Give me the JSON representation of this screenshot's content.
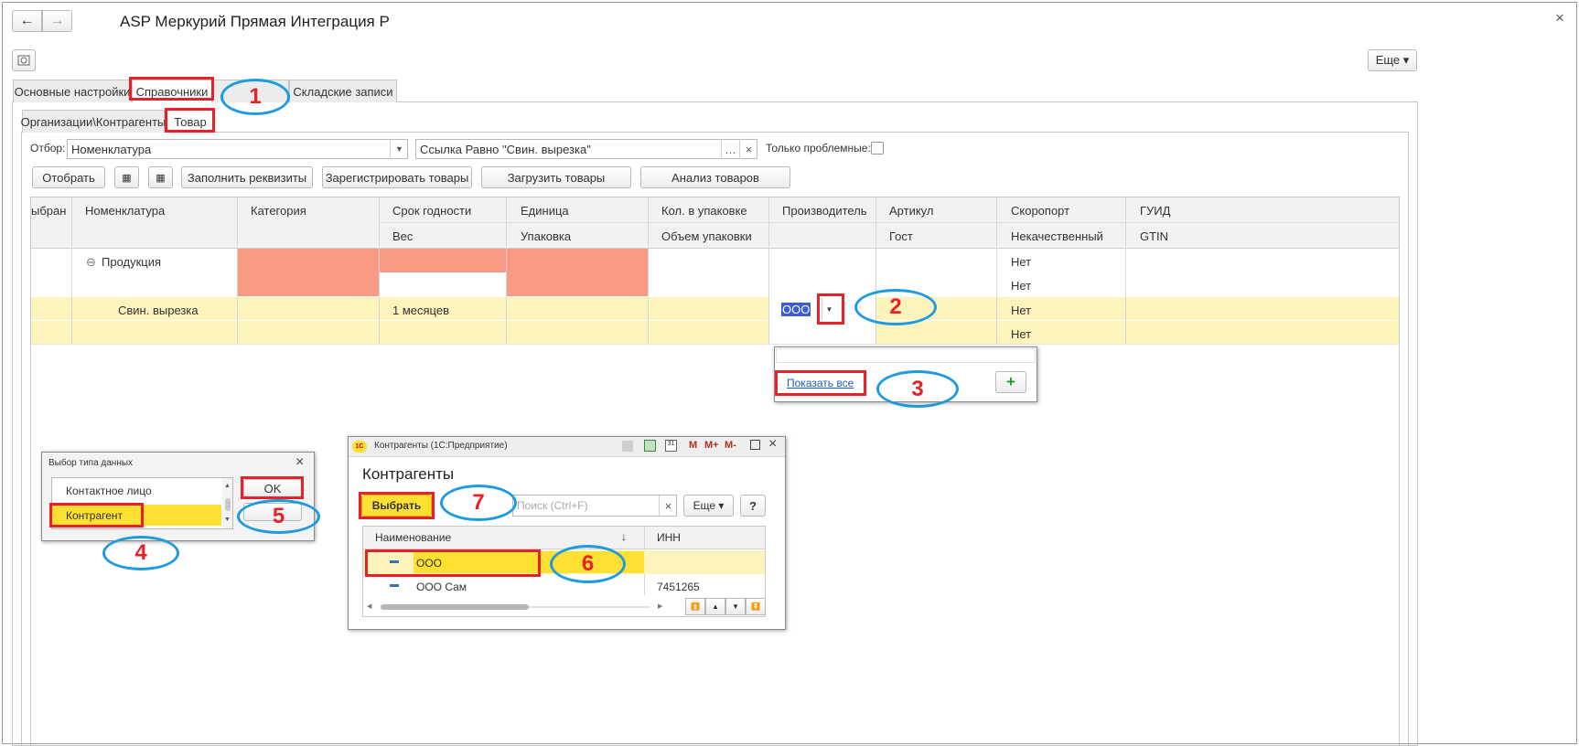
{
  "window": {
    "title": "ASP Меркурий Прямая Интеграция Р",
    "back_icon": "←",
    "forward_icon": "→",
    "close_icon": "×",
    "more_label": "Еще ▾"
  },
  "tabs": {
    "main": [
      "Основные настройки",
      "Справочники",
      "",
      "Складские записи"
    ],
    "sub": [
      "Организации\\Контрагенты",
      "Товар"
    ]
  },
  "filter": {
    "label": "Отбор:",
    "field_value": "Номенклатура",
    "condition_value": "Ссылка Равно \"Свин. вырезка\"",
    "problem_only_label": "Только проблемные:"
  },
  "toolbar": {
    "select": "Отобрать",
    "fill_props": "Заполнить реквизиты",
    "register_goods": "Зарегистрировать товары",
    "load_goods": "Загрузить товары",
    "analyze_goods": "Анализ товаров"
  },
  "grid": {
    "headers_row1": [
      "ыбран",
      "Номенклатура",
      "Категория",
      "Срок годности",
      "Единица",
      "Кол. в упаковке",
      "Производитель",
      "Артикул",
      "Скоропорт",
      "ГУИД"
    ],
    "headers_row2": [
      "",
      "",
      "",
      "Вес",
      "Упаковка",
      "Объем упаковки",
      "",
      "Гост",
      "Некачественный",
      "GTIN"
    ],
    "rows": [
      {
        "name": "Продукция",
        "expand_icon": "⊖",
        "perishable": "Нет",
        "defective": "Нет"
      },
      {
        "name": "Свин. вырезка",
        "shelf_life": "1 месяцев",
        "manufacturer": "ООО",
        "perishable": "Нет",
        "defective": "Нет"
      }
    ]
  },
  "dropdown": {
    "show_all": "Показать все",
    "add_icon": "+"
  },
  "type_dialog": {
    "title": "Выбор типа данных",
    "items": [
      "Контактное лицо",
      "Контрагент"
    ],
    "ok": "OK"
  },
  "contractors_dialog": {
    "window_title": "Контрагенты (1С:Предприятие)",
    "app_badge": "1С",
    "header": "Контрагенты",
    "choose": "Выбрать",
    "search_placeholder": "Поиск (Ctrl+F)",
    "more": "Еще ▾",
    "help": "?",
    "title_tools": [
      "M",
      "M+",
      "M-"
    ],
    "columns": [
      "Наименование",
      "ИНН"
    ],
    "sort_icon": "↓",
    "rows": [
      {
        "name": "ООО",
        "inn": ""
      },
      {
        "name": "ООО  Сам",
        "inn": "7451265"
      }
    ]
  },
  "callouts": [
    "1",
    "2",
    "3",
    "4",
    "5",
    "6",
    "7"
  ],
  "colors": {
    "highlight_row": "#fcf3bd",
    "yellow": "#fde031",
    "salmon": "#f99a84",
    "annotation_red": "#e8202a",
    "annotation_blue": "#1e9be0"
  }
}
